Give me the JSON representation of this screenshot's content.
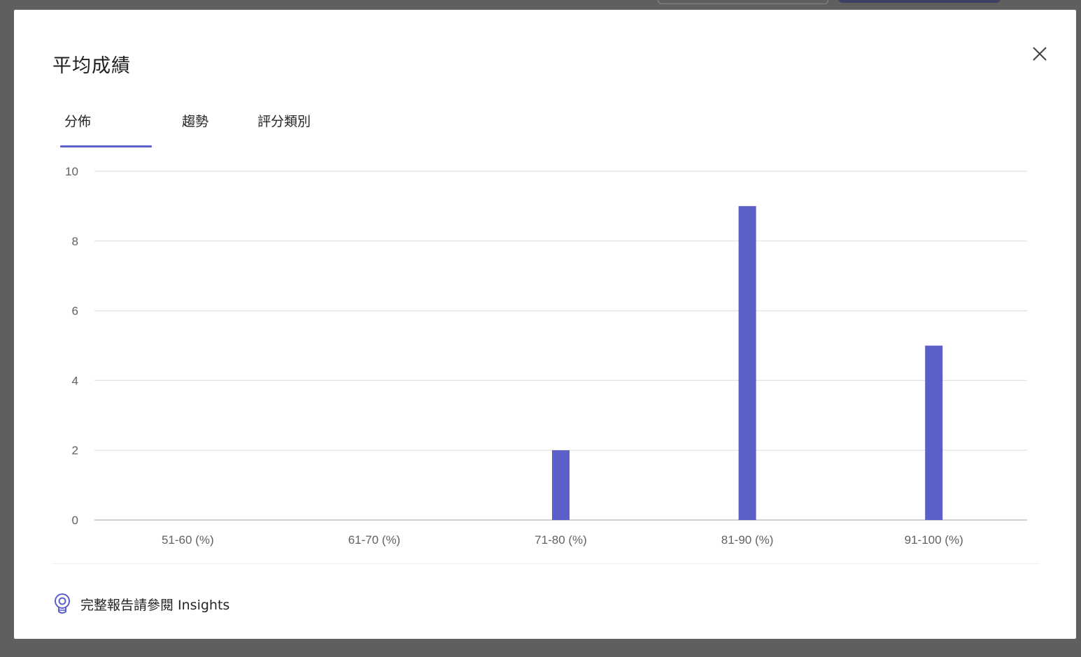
{
  "dialog": {
    "title": "平均成績",
    "close_icon": "close-icon",
    "tabs": [
      {
        "label": "分佈",
        "active": true
      },
      {
        "label": "趨勢",
        "active": false
      },
      {
        "label": "評分類別",
        "active": false
      }
    ],
    "footer": {
      "icon": "lightbulb-icon",
      "text": "完整報告請參閱 Insights"
    }
  },
  "colors": {
    "accent": "#5b5fc7",
    "text": "#242424",
    "grid": "#e1e1e1",
    "axis_text": "#616161"
  },
  "chart_data": {
    "type": "bar",
    "categories": [
      "51-60 (%)",
      "61-70 (%)",
      "71-80 (%)",
      "81-90 (%)",
      "91-100 (%)"
    ],
    "values": [
      0,
      0,
      2,
      9,
      5
    ],
    "yticks": [
      "0",
      "2",
      "4",
      "6",
      "8",
      "10"
    ],
    "ylim": [
      0,
      10
    ],
    "grid": true,
    "title": "",
    "xlabel": "",
    "ylabel": ""
  }
}
